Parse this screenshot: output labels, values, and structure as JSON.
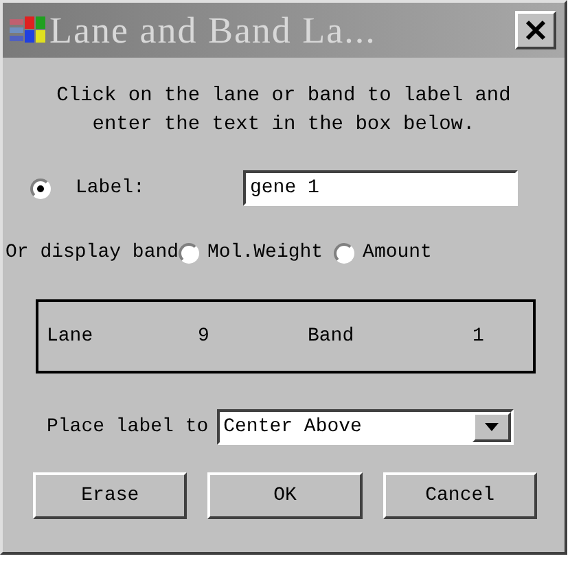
{
  "window": {
    "title": "Lane and Band La..."
  },
  "instructions": "Click on the lane or band to label and enter the text in the box below.",
  "label_option": {
    "label": "Label:",
    "selected": true
  },
  "label_field": {
    "value": "gene 1"
  },
  "display_band": {
    "label": "Or display band",
    "options": [
      {
        "label": "Mol.Weight",
        "selected": false
      },
      {
        "label": "Amount",
        "selected": false
      }
    ]
  },
  "info": [
    {
      "text": "Lane"
    },
    {
      "text": "9"
    },
    {
      "text": "Band"
    },
    {
      "text": "1"
    }
  ],
  "place": {
    "label": "Place label to",
    "value": "Center Above"
  },
  "buttons": [
    "Erase",
    "OK",
    "Cancel"
  ]
}
